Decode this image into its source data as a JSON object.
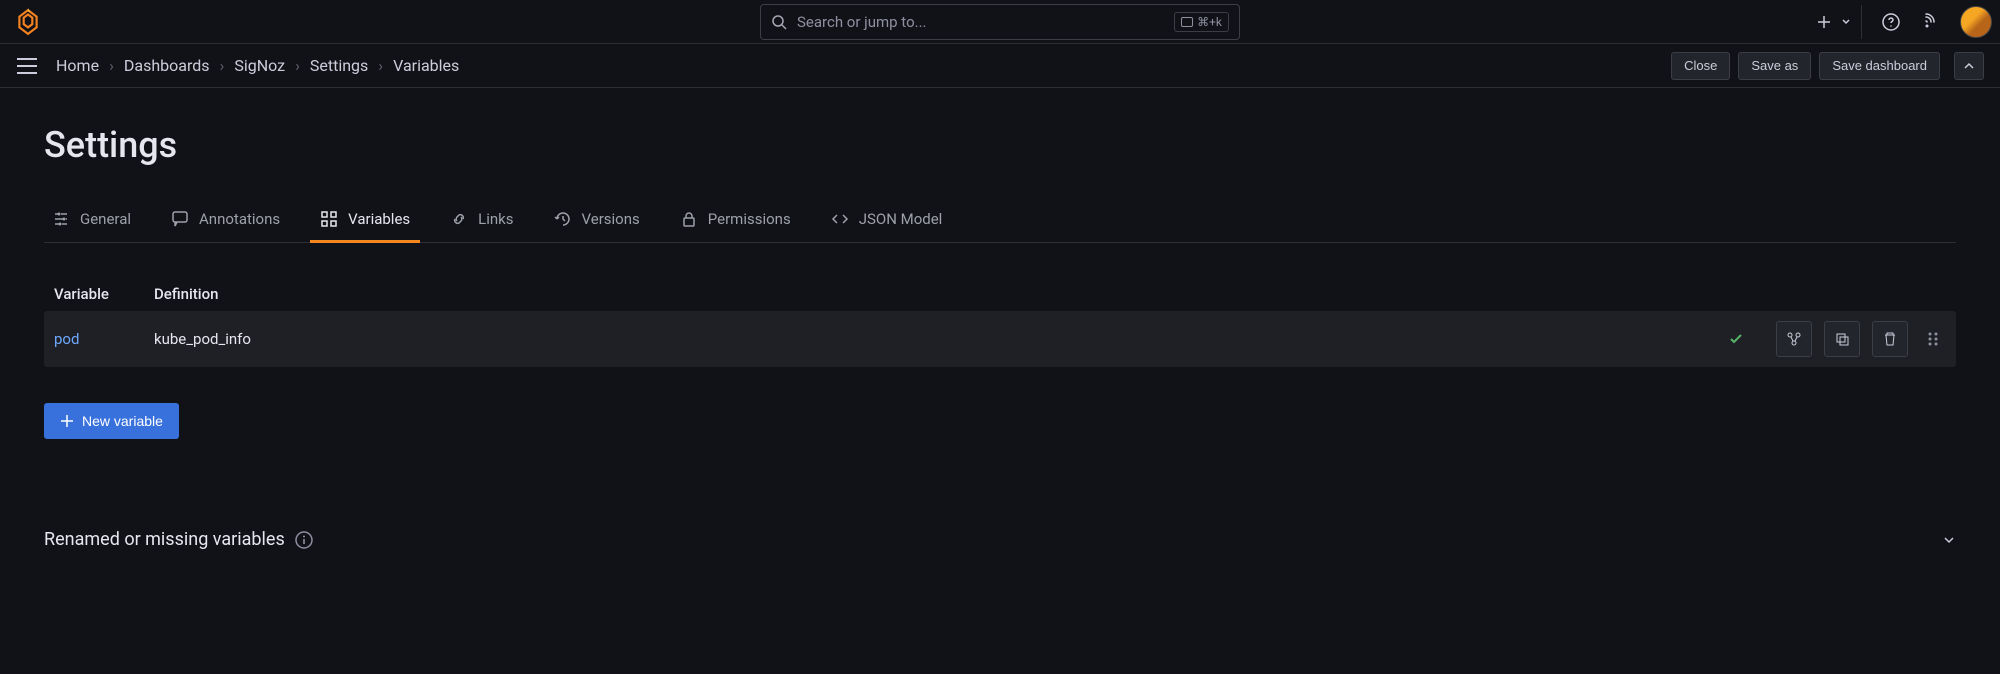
{
  "search": {
    "placeholder": "Search or jump to...",
    "shortcut": "⌘+k"
  },
  "breadcrumb": {
    "items": [
      "Home",
      "Dashboards",
      "SigNoz",
      "Settings",
      "Variables"
    ]
  },
  "actions": {
    "close": "Close",
    "save_as": "Save as",
    "save_dashboard": "Save dashboard"
  },
  "page": {
    "title": "Settings"
  },
  "tabs": [
    {
      "label": "General"
    },
    {
      "label": "Annotations"
    },
    {
      "label": "Variables",
      "active": true
    },
    {
      "label": "Links"
    },
    {
      "label": "Versions"
    },
    {
      "label": "Permissions"
    },
    {
      "label": "JSON Model"
    }
  ],
  "table": {
    "headers": {
      "variable": "Variable",
      "definition": "Definition"
    },
    "rows": [
      {
        "name": "pod",
        "definition": "kube_pod_info"
      }
    ]
  },
  "new_variable": "New variable",
  "renamed_section": "Renamed or missing variables"
}
